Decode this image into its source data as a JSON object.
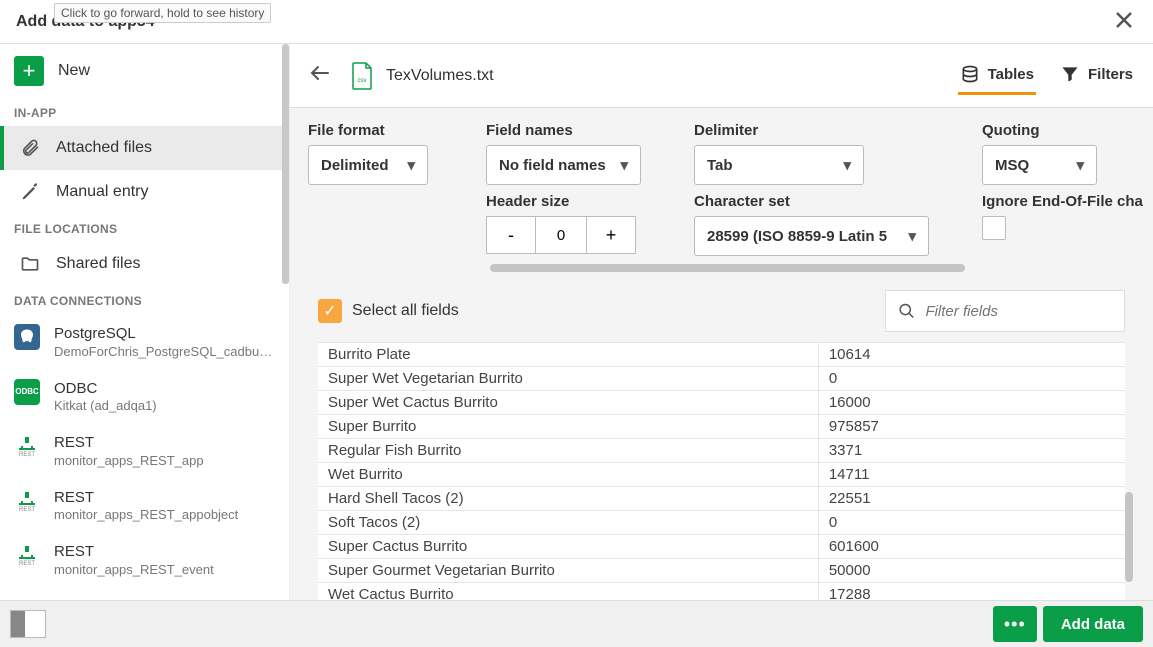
{
  "tooltip": "Click to go forward, hold to see history",
  "header": {
    "title": "Add data to app34"
  },
  "sidebar": {
    "new_label": "New",
    "sections": {
      "inapp": "IN-APP",
      "file_locations": "FILE LOCATIONS",
      "data_connections": "DATA CONNECTIONS"
    },
    "items": {
      "attached": "Attached files",
      "manual": "Manual entry",
      "shared": "Shared files"
    },
    "connections": [
      {
        "title": "PostgreSQL",
        "sub": "DemoForChris_PostgreSQL_cadbury...."
      },
      {
        "title": "ODBC",
        "sub": "Kitkat (ad_adqa1)"
      },
      {
        "title": "REST",
        "sub": "monitor_apps_REST_app"
      },
      {
        "title": "REST",
        "sub": "monitor_apps_REST_appobject"
      },
      {
        "title": "REST",
        "sub": "monitor_apps_REST_event"
      }
    ]
  },
  "main": {
    "file_name": "TexVolumes.txt",
    "tabs": {
      "tables": "Tables",
      "filters": "Filters"
    },
    "config": {
      "file_format": {
        "label": "File format",
        "value": "Delimited"
      },
      "field_names": {
        "label": "Field names",
        "value": "No field names"
      },
      "delimiter": {
        "label": "Delimiter",
        "value": "Tab"
      },
      "quoting": {
        "label": "Quoting",
        "value": "MSQ"
      },
      "header_size": {
        "label": "Header size",
        "value": "0"
      },
      "charset": {
        "label": "Character set",
        "value": "28599 (ISO 8859-9 Latin 5"
      },
      "ignore_eof": {
        "label": "Ignore End-Of-File cha"
      }
    },
    "select_all": "Select all fields",
    "filter_placeholder": "Filter fields",
    "rows": [
      {
        "name": "Burrito Plate",
        "val": "10614"
      },
      {
        "name": "Super Wet Vegetarian Burrito",
        "val": "0"
      },
      {
        "name": "Super Wet Cactus Burrito",
        "val": "16000"
      },
      {
        "name": "Super Burrito",
        "val": "975857"
      },
      {
        "name": "Regular Fish Burrito",
        "val": "3371"
      },
      {
        "name": "Wet Burrito",
        "val": "14711"
      },
      {
        "name": "Hard Shell Tacos (2)",
        "val": "22551"
      },
      {
        "name": "Soft Tacos (2)",
        "val": "0"
      },
      {
        "name": "Super Cactus Burrito",
        "val": "601600"
      },
      {
        "name": "Super Gourmet Vegetarian Burrito",
        "val": "50000"
      },
      {
        "name": "Wet Cactus Burrito",
        "val": "17288"
      }
    ]
  },
  "footer": {
    "add_data": "Add data"
  }
}
